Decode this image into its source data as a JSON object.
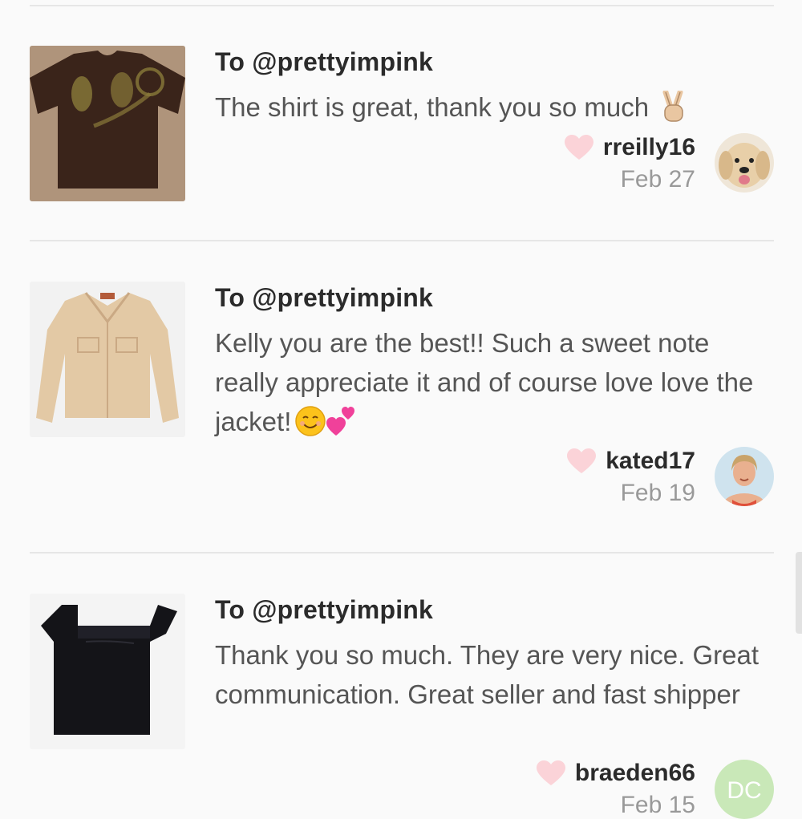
{
  "reviews": [
    {
      "recipient": "To @prettyimpink",
      "message": "The shirt is great, thank you so much",
      "emoji": "✌🏼",
      "username": "rreilly16",
      "date": "Feb 27",
      "item_icon": "tshirt-photo",
      "avatar_icon": "dog-avatar"
    },
    {
      "recipient": "To @prettyimpink",
      "message": "Kelly you are the best!! Such a sweet note really appreciate it and of course love love the jacket!",
      "emoji": "☺️💕",
      "username": "kated17",
      "date": "Feb 19",
      "item_icon": "jacket-photo",
      "avatar_icon": "woman-avatar"
    },
    {
      "recipient": "To @prettyimpink",
      "message": "Thank you so much. They are very nice. Great communication. Great seller and fast shipper",
      "username": "braeden66",
      "date": "Feb 15",
      "avatar_initials": "DC",
      "item_icon": "pants-photo"
    }
  ],
  "colors": {
    "heart": "#fbd3d8",
    "avatar_initials_bg": "#c9e8b8",
    "divider": "#e6e6e6"
  }
}
